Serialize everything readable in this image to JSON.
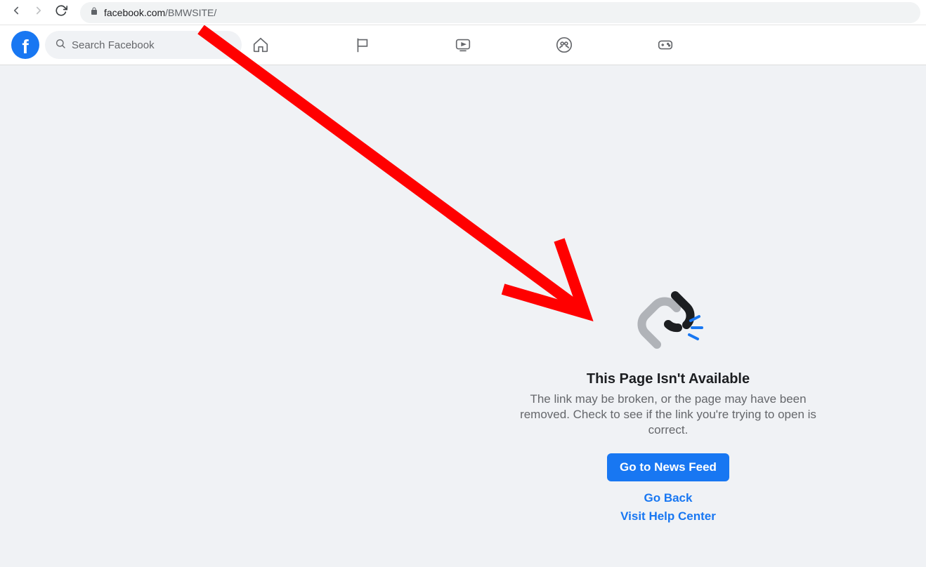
{
  "browser": {
    "url_host": "facebook.com",
    "url_path": "/BMWSITE/"
  },
  "fb": {
    "search_placeholder": "Search Facebook"
  },
  "error": {
    "title": "This Page Isn't Available",
    "description": "The link may be broken, or the page may have been removed. Check to see if the link you're trying to open is correct.",
    "primary_button": "Go to News Feed",
    "go_back": "Go Back",
    "help_center": "Visit Help Center"
  }
}
